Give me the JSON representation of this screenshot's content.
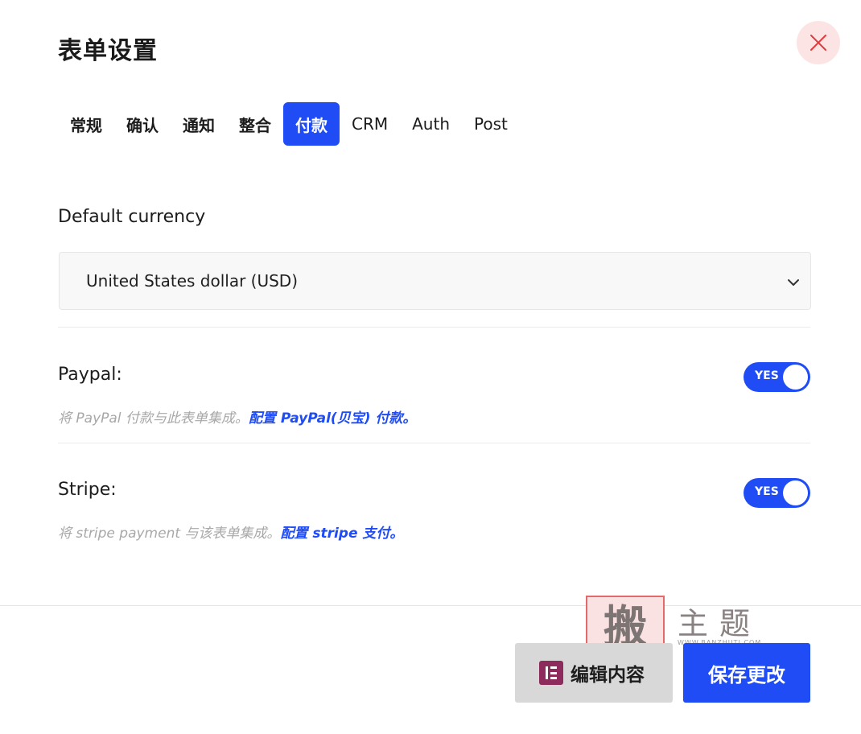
{
  "modal": {
    "title": "表单设置"
  },
  "tabs": [
    {
      "label": "常规"
    },
    {
      "label": "确认"
    },
    {
      "label": "通知"
    },
    {
      "label": "整合"
    },
    {
      "label": "付款",
      "active": true
    },
    {
      "label": "CRM"
    },
    {
      "label": "Auth"
    },
    {
      "label": "Post"
    }
  ],
  "currency": {
    "label": "Default currency",
    "selected": "United States dollar (USD)"
  },
  "paypal": {
    "label": "Paypal:",
    "toggle_text": "YES",
    "enabled": true,
    "help_text": "将 PayPal 付款与此表单集成。",
    "help_link": "配置 PayPal(贝宝) 付款。"
  },
  "stripe": {
    "label": "Stripe:",
    "toggle_text": "YES",
    "enabled": true,
    "help_text": "将 stripe payment 与该表单集成。",
    "help_link": "配置 stripe 支付。"
  },
  "footer": {
    "edit_label": "编辑内容",
    "save_label": "保存更改"
  },
  "watermark": {
    "stamp_char": "搬",
    "chars": "主题",
    "url": "WWW.BANZHUTI.COM"
  },
  "colors": {
    "accent": "#1f4cf4",
    "close_bg": "#fde4e4",
    "close_icon": "#e03a3a",
    "elementor": "#8d2c5c"
  },
  "icons": {
    "close": "close-icon",
    "chevron": "chevron-down-icon",
    "elementor": "elementor-icon"
  }
}
